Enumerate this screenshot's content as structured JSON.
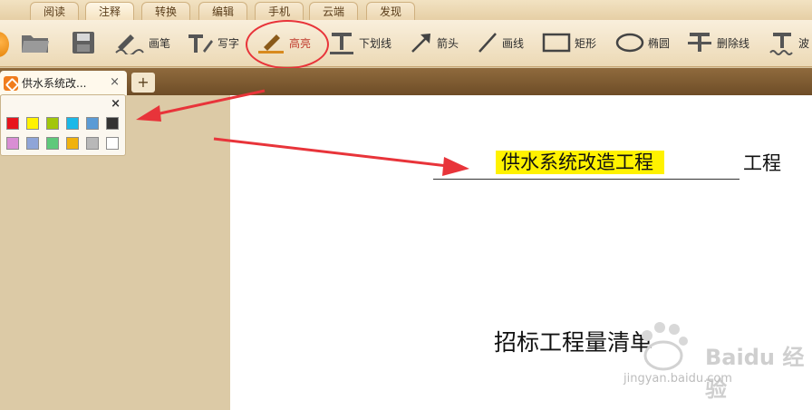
{
  "menu_tabs": [
    "阅读",
    "注释",
    "转换",
    "编辑",
    "手机",
    "云端",
    "发现"
  ],
  "toolbar": {
    "pen_label": "画笔",
    "write_label": "写字",
    "highlight_label": "高亮",
    "underline_label": "下划线",
    "arrow_label": "箭头",
    "line_label": "画线",
    "rect_label": "矩形",
    "ellipse_label": "椭圆",
    "strike_label": "删除线",
    "wave_label": "波"
  },
  "document_tab": {
    "title": "供水系统改...",
    "close": "×",
    "new_tab": "+"
  },
  "palette": {
    "close": "×",
    "colors_row1": [
      "#e8141c",
      "#fff200",
      "#a2c60a",
      "#1bb8e8",
      "#5b9bd5",
      "#333333"
    ],
    "colors_row2": [
      "#d98ed4",
      "#8fa5d8",
      "#5ec97a",
      "#f0b20e",
      "#b8b8b8",
      "#ffffff"
    ]
  },
  "document": {
    "highlighted_text": "供水系统改造工程",
    "trailing_text": "工程",
    "subtitle": "招标工程量清单"
  },
  "watermark": {
    "brand": "Baidu 经验",
    "url": "jingyan.baidu.com"
  }
}
